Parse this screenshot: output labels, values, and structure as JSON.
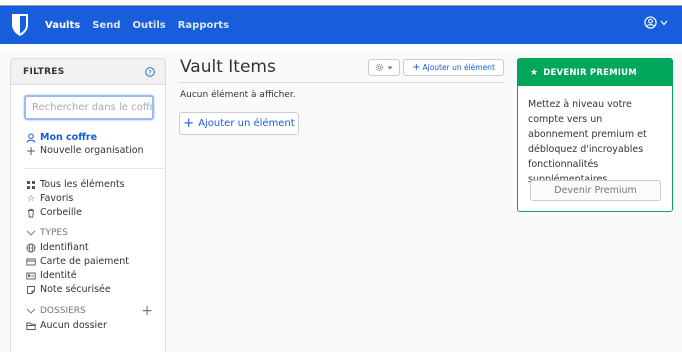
{
  "navbar": {
    "items": [
      {
        "label": "Vaults"
      },
      {
        "label": "Send"
      },
      {
        "label": "Outils"
      },
      {
        "label": "Rapports"
      }
    ]
  },
  "sidebar": {
    "title": "FILTRES",
    "search_placeholder": "Rechercher dans le coffre",
    "vault_items": [
      {
        "label": "Mon coffre",
        "icon": "user-icon",
        "selected": true
      },
      {
        "label": "Nouvelle organisation",
        "icon": "plus-icon"
      }
    ],
    "filter_items": [
      {
        "label": "Tous les éléments",
        "icon": "grid-icon"
      },
      {
        "label": "Favoris",
        "icon": "star-icon"
      },
      {
        "label": "Corbeille",
        "icon": "trash-icon"
      }
    ],
    "types_label": "TYPES",
    "types": [
      {
        "label": "Identifiant",
        "icon": "globe-icon"
      },
      {
        "label": "Carte de paiement",
        "icon": "credit-card-icon"
      },
      {
        "label": "Identité",
        "icon": "id-card-icon"
      },
      {
        "label": "Note sécurisée",
        "icon": "sticky-note-icon"
      }
    ],
    "folders_label": "DOSSIERS",
    "folders": [
      {
        "label": "Aucun dossier",
        "icon": "folder-icon"
      }
    ]
  },
  "main": {
    "title": "Vault Items",
    "add_item_small": "Ajouter un élément",
    "empty_text": "Aucun élément à afficher.",
    "add_item": "Ajouter un élément"
  },
  "premium": {
    "title": "DEVENIR PREMIUM",
    "description": "Mettez à niveau votre compte vers un abonnement premium et débloquez d'incroyables fonctionnalités supplémentaires.",
    "button": "Devenir Premium"
  },
  "colors": {
    "brand": "#175ddc",
    "premium": "#00a65a"
  }
}
